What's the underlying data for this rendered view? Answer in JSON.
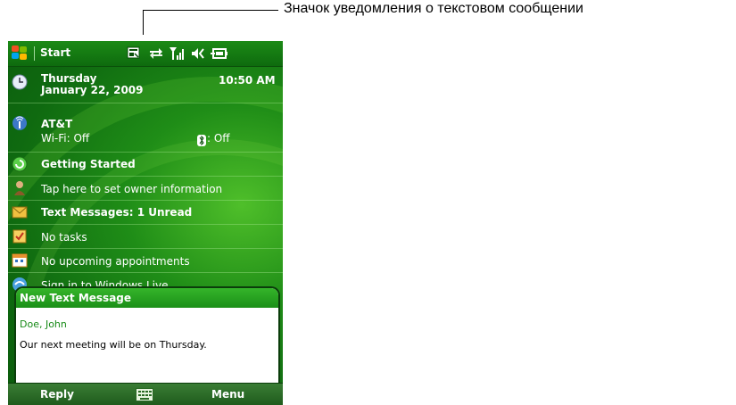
{
  "annotation": {
    "text": "Значок уведомления о текстовом сообщении"
  },
  "titlebar": {
    "start_label": "Start"
  },
  "today": {
    "date": {
      "day": "Thursday",
      "full_date": "January 22, 2009",
      "time": "10:50 AM"
    },
    "connections": {
      "carrier": "AT&T",
      "wifi_status": "Wi-Fi: Off",
      "bluetooth_status": ": Off"
    },
    "items": [
      {
        "label": "Getting Started",
        "icon": "getting-started-icon"
      },
      {
        "label": "Tap here to set owner information",
        "icon": "owner-icon"
      },
      {
        "label": "Text Messages: 1 Unread",
        "icon": "messages-icon"
      },
      {
        "label": "No tasks",
        "icon": "tasks-icon"
      },
      {
        "label": "No upcoming appointments",
        "icon": "calendar-icon"
      },
      {
        "label": "Sign in to Windows Live",
        "icon": "windows-live-icon"
      }
    ]
  },
  "notification": {
    "title": "New Text Message",
    "sender": "Doe, John",
    "body": "Our next meeting will be on Thursday."
  },
  "softkeys": {
    "left": "Reply",
    "right": "Menu"
  },
  "colors": {
    "accent_green": "#1f8d17",
    "sender_green": "#178a17"
  }
}
